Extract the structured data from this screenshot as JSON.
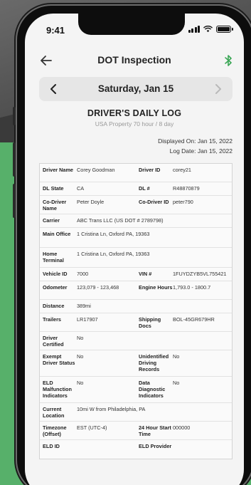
{
  "status_bar": {
    "time": "9:41"
  },
  "nav": {
    "title": "DOT Inspection"
  },
  "date_selector": {
    "date": "Saturday, Jan 15"
  },
  "log": {
    "title": "DRIVER'S DAILY LOG",
    "subtitle": "USA Property 70 hour / 8 day",
    "displayed_on": "Displayed On: Jan 15, 2022",
    "log_date": "Log Date: Jan 15, 2022"
  },
  "fields": {
    "driver_name": {
      "label": "Driver Name",
      "value": "Corey Goodman"
    },
    "driver_id": {
      "label": "Driver ID",
      "value": "corey21"
    },
    "dl_state": {
      "label": "DL State",
      "value": "CA"
    },
    "dl_number": {
      "label": "DL #",
      "value": "R48870879"
    },
    "co_driver_name": {
      "label": "Co-Driver Name",
      "value": "Peter Doyle"
    },
    "co_driver_id": {
      "label": "Co-Driver ID",
      "value": "peter790"
    },
    "carrier": {
      "label": "Carrier",
      "value": "ABC Trans LLC (US DOT # 2789798)"
    },
    "main_office": {
      "label": "Main Office",
      "value": "1 Cristina Ln, Oxford PA, 19363"
    },
    "home_terminal": {
      "label": "Home Terminal",
      "value": "1 Cristina Ln, Oxford PA, 19363"
    },
    "vehicle_id": {
      "label": "Vehicle ID",
      "value": "7000"
    },
    "vin": {
      "label": "VIN #",
      "value": "1FUYDZYB5VL755421"
    },
    "odometer": {
      "label": "Odometer",
      "value": "123,079 - 123,468"
    },
    "engine_hours": {
      "label": "Engine Hours",
      "value": "1,793.0 - 1800.7"
    },
    "distance": {
      "label": "Distance",
      "value": "389mi"
    },
    "trailers": {
      "label": "Trailers",
      "value": "LR17907"
    },
    "shipping_docs": {
      "label": "Shipping Docs",
      "value": "BOL-45GR679HR"
    },
    "driver_certified": {
      "label": "Driver Certified",
      "value": "No"
    },
    "exempt_driver_status": {
      "label": "Exempt Driver Status",
      "value": "No"
    },
    "unidentified_driving_records": {
      "label": "Unidentified Driving Records",
      "value": "No"
    },
    "eld_malfunction_indicators": {
      "label": "ELD Malfunction Indicators",
      "value": "No"
    },
    "data_diagnostic_indicators": {
      "label": "Data Diagnostic Indicators",
      "value": "No"
    },
    "current_location": {
      "label": "Current Location",
      "value": "10mi W from Philadelphia, PA"
    },
    "timezone_offset": {
      "label": "Timezone (Offset)",
      "value": "EST (UTC-4)"
    },
    "start_time_24h": {
      "label": "24 Hour Start Time",
      "value": "000000"
    },
    "eld_id": {
      "label": "ELD ID",
      "value": ""
    },
    "eld_provider": {
      "label": "ELD Provider",
      "value": ""
    }
  },
  "colors": {
    "accent": "#3aa655",
    "background_green": "#57b06a"
  },
  "icons": {
    "back": "arrow-left-icon",
    "bluetooth": "bluetooth-icon",
    "prev": "chevron-left-icon",
    "next": "chevron-right-icon"
  }
}
